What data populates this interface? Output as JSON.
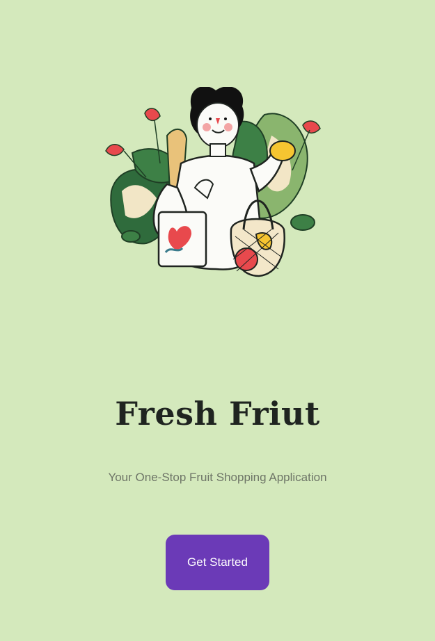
{
  "hero": {
    "illustration": "woman-with-shopping-bags-illustration"
  },
  "title": "Fresh Friut",
  "subtitle": "Your One-Stop Fruit Shopping Application",
  "cta": {
    "label": "Get Started"
  },
  "colors": {
    "background": "#d4e9bc",
    "accent": "#6b3ab7",
    "title": "#1f2420",
    "subtitle": "#6e7567"
  }
}
